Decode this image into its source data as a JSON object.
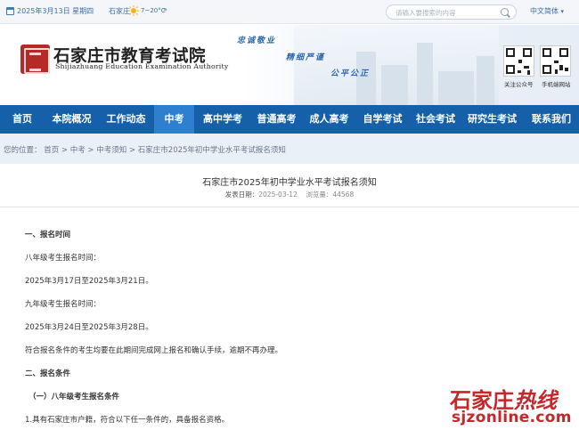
{
  "topbar": {
    "date": "2025年3月13日 星期四",
    "city": "石家庄",
    "weather_icon": "sun-icon",
    "temperature": "7~20°C",
    "more": "»",
    "search_placeholder": "请输入要搜索的内容",
    "language": "中文简体",
    "language_caret": "▾"
  },
  "header": {
    "logo_cn": "石家庄市教育考试院",
    "logo_en": "Shijiazhuang Education Examination Authority",
    "slogans": [
      "忠诚敬业",
      "精细严谨",
      "公平公正"
    ],
    "qr_codes": [
      {
        "label": "关注公众号"
      },
      {
        "label": "手机端网站"
      }
    ]
  },
  "nav": {
    "items": [
      "首页",
      "本院概况",
      "工作动态",
      "中考",
      "高中学考",
      "普通高考",
      "成人高考",
      "自学考试",
      "社会考试",
      "研究生考试",
      "联系我们"
    ],
    "active_index": 3
  },
  "breadcrumb": "您的位置： 首页 > 中考 > 中考须知 > 石家庄市2025年初中学业水平考试报名须知",
  "article": {
    "title": "石家庄市2025年初中学业水平考试报名须知",
    "date_label": "发表日期：",
    "date": "2025-03-12",
    "views_label": "浏览量：",
    "views": "44568",
    "paragraphs": [
      {
        "text": "一、报名时间",
        "bold": true
      },
      {
        "text": "八年级考生报名时间：",
        "bold": false
      },
      {
        "text": "2025年3月17日至2025年3月21日。",
        "bold": false
      },
      {
        "text": "九年级考生报名时间：",
        "bold": false
      },
      {
        "text": "2025年3月24日至2025年3月28日。",
        "bold": false
      },
      {
        "text": "符合报名条件的考生均要在此期间完成网上报名和确认手续，逾期不再办理。",
        "bold": false
      },
      {
        "text": "二、报名条件",
        "bold": true
      },
      {
        "text": "（一）八年级考生报名条件",
        "bold": true
      },
      {
        "text": "1.具有石家庄市户籍，符合以下任一条件的，具备报名资格。",
        "bold": false
      }
    ]
  },
  "watermark": {
    "cn_main": "石家庄",
    "cn_hot": "热线",
    "domain": "sjzonline.com"
  },
  "colors": {
    "nav_bg": "#1660aa",
    "nav_active": "#2f7fd1",
    "breadcrumb_bg": "#e9f0f8",
    "watermark": "#c7262b",
    "link": "#3d6fa5"
  }
}
